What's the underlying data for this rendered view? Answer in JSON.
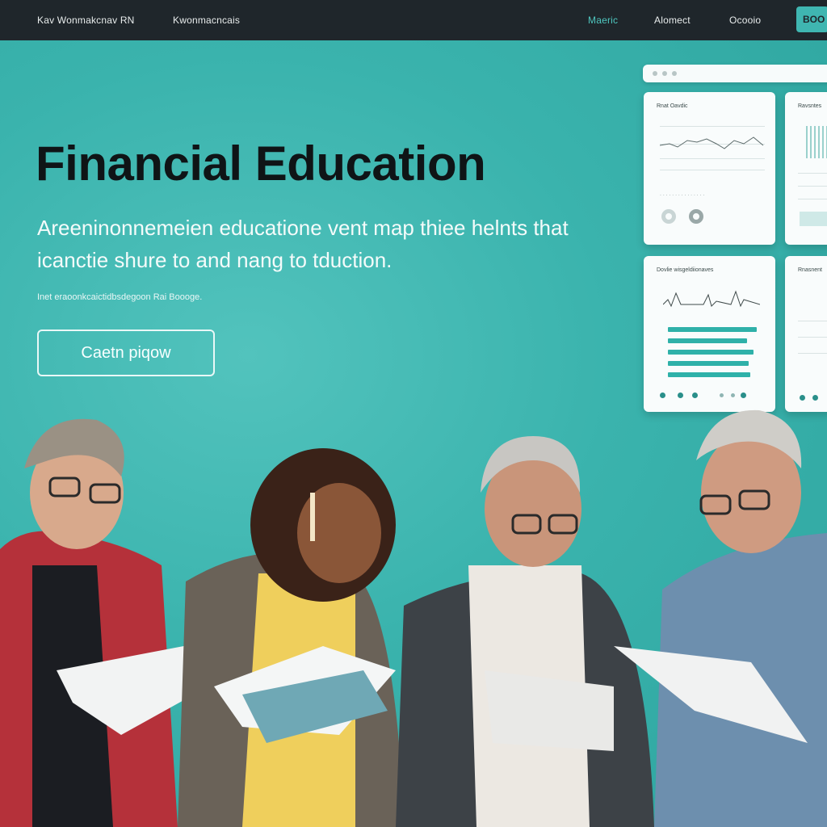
{
  "nav": {
    "brand": "Kav Wonmakcnav RN",
    "link_left": "Kwonmacncais",
    "links": [
      "Maeric",
      "Alomect",
      "Ocooio"
    ],
    "cta": "BOO"
  },
  "hero": {
    "title": "Financial Education",
    "subtitle": "Areeninonnemeien educatione vent map thiee helnts that icanctie shure to and nang to tduction.",
    "note": "Inet eraoonkcaictidbsdegoon Rai Boooge.",
    "button": "Caetn piqow"
  },
  "dashboard": {
    "card1_title": "Rnat Oavdic",
    "card2_title": "Ravsntes",
    "card3_title": "Dovlie wisgeldiionaves",
    "card4_title": "Rnasnent"
  },
  "colors": {
    "accent": "#3fb6b1",
    "topbar": "#1f262b",
    "headline": "#0f1416"
  }
}
